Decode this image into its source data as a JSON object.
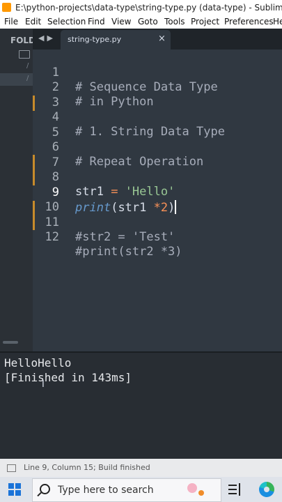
{
  "window": {
    "title": "E:\\python-projects\\data-type\\string-type.py (data-type) - Sublime Text (UNRE"
  },
  "menu": [
    "File",
    "Edit",
    "Selection",
    "Find",
    "View",
    "Goto",
    "Tools",
    "Project",
    "Preferences",
    "He"
  ],
  "sidebar": {
    "label": "FOLD"
  },
  "tabs": [
    {
      "label": "string-type.py",
      "close": "×"
    }
  ],
  "editor": {
    "lines": [
      {
        "n": "1",
        "text": "# Sequence Data Type"
      },
      {
        "n": "2",
        "text": "# in Python"
      },
      {
        "n": "3",
        "text": ""
      },
      {
        "n": "4",
        "text": "# 1. String Data Type"
      },
      {
        "n": "5",
        "text": ""
      },
      {
        "n": "6",
        "text": "# Repeat Operation"
      },
      {
        "n": "7",
        "text": ""
      },
      {
        "n": "8",
        "text": "str1 = 'Hello'"
      },
      {
        "n": "9",
        "text": "print(str1 *2)"
      },
      {
        "n": "10",
        "text": ""
      },
      {
        "n": "11",
        "text": "#str2 = 'Test'"
      },
      {
        "n": "12",
        "text": "#print(str2 *3)"
      }
    ],
    "tokens": {
      "l8_var": "str1",
      "l8_eq": " = ",
      "l8_str": "'Hello'",
      "l9_fn": "print",
      "l9_open": "(",
      "l9_var": "str1 ",
      "l9_op": "*",
      "l9_num": "2",
      "l9_close": ")"
    }
  },
  "output": {
    "line1": "HelloHello",
    "line2": "[Finished in 143ms]"
  },
  "status": {
    "text": "Line 9, Column 15; Build finished"
  },
  "taskbar": {
    "search_placeholder": "Type here to search"
  },
  "colors": {
    "editor_bg": "#303841",
    "comment": "#a7adba",
    "string": "#99c794",
    "function": "#6699cc",
    "number": "#f99157",
    "gutter_mark": "#c78b2b"
  }
}
